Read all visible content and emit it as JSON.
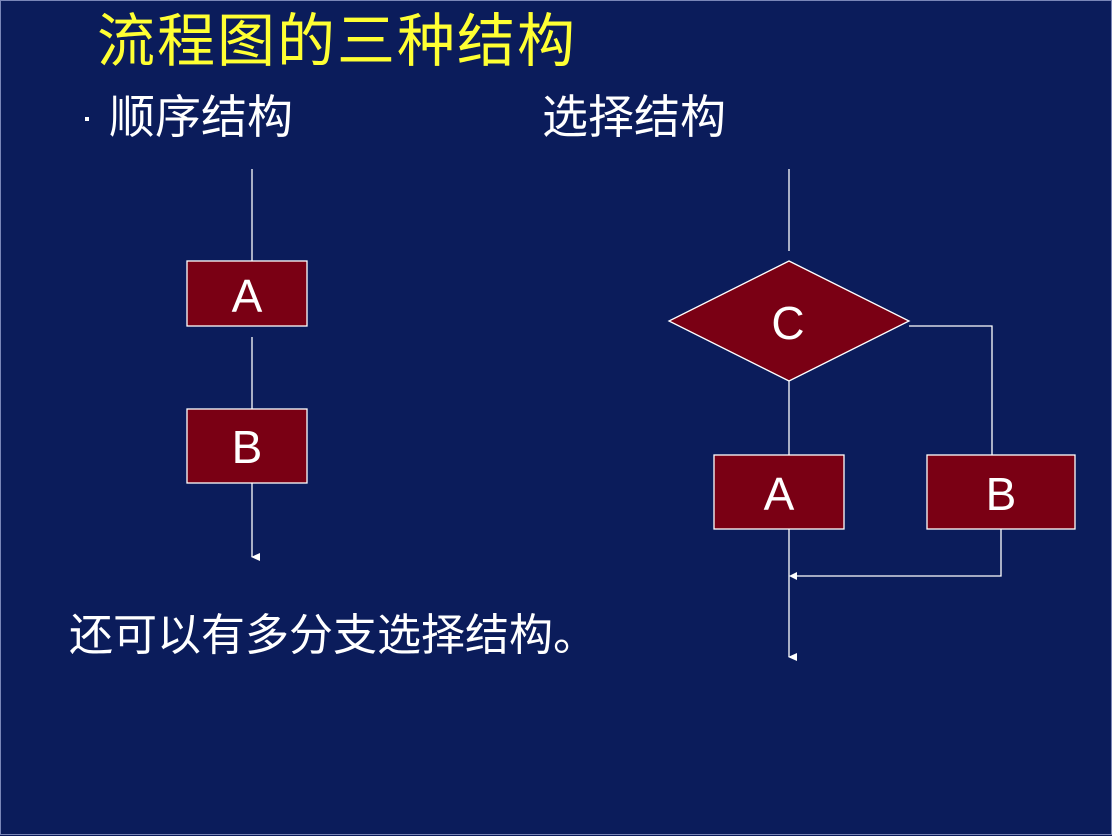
{
  "title": "流程图的三种结构",
  "sections": {
    "sequence": {
      "heading": "顺序结构",
      "box_a": "A",
      "box_b": "B"
    },
    "selection": {
      "heading": "选择结构",
      "decision": "C",
      "box_a": "A",
      "box_b": "B"
    }
  },
  "note": "还可以有多分支选择结构。",
  "colors": {
    "background": "#0b1c5b",
    "title": "#ffff33",
    "box_fill": "#7a0014",
    "line": "#ffffff"
  }
}
